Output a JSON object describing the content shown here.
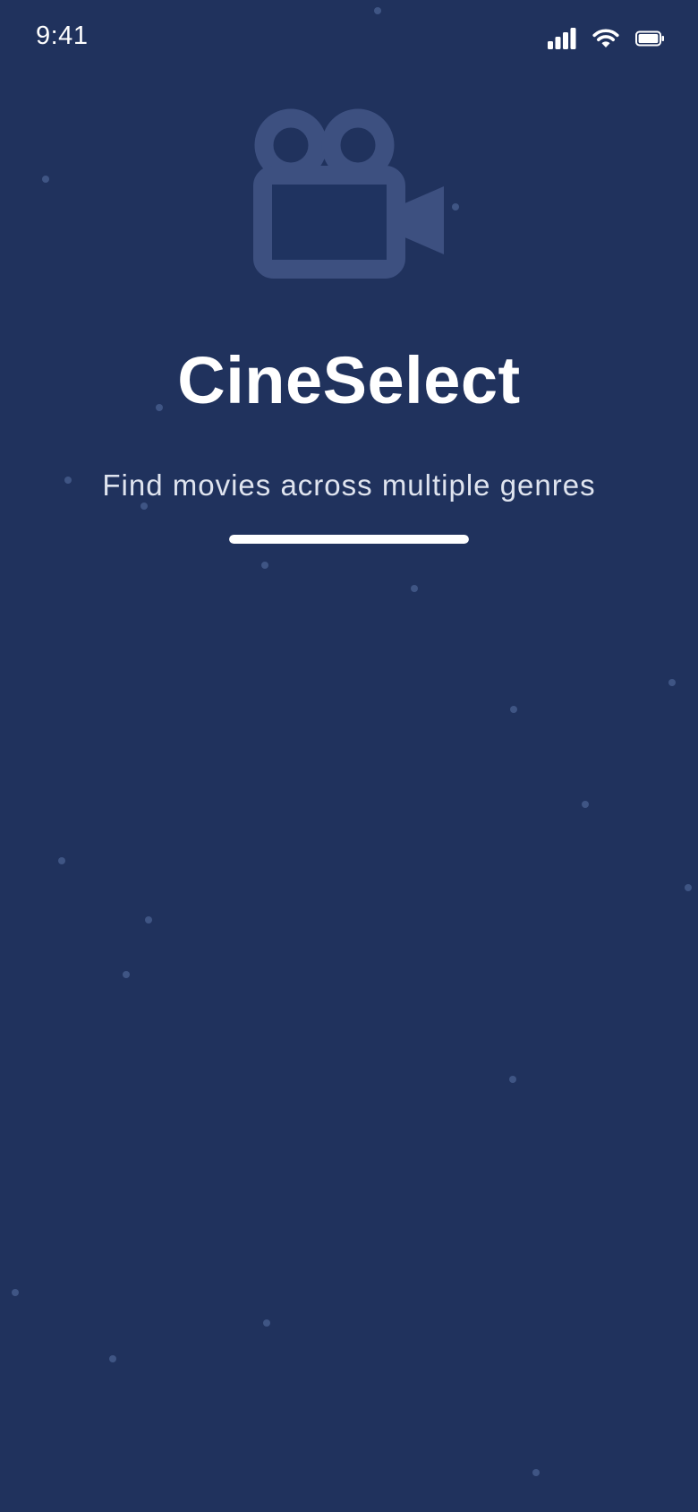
{
  "status_bar": {
    "time": "9:41",
    "icons": [
      "cellular-signal-icon",
      "wifi-icon",
      "battery-icon"
    ]
  },
  "splash": {
    "logo_icon": "movie-camera-icon",
    "title": "CineSelect",
    "tagline": "Find movies across multiple genres",
    "loading_progress": 1.0
  },
  "colors": {
    "background": "#20325d",
    "logo": "#3d5080",
    "logo_inner": "#1f3360",
    "text_primary": "#ffffff",
    "text_secondary": "#dfe4ef",
    "dot": "#3f5584"
  }
}
